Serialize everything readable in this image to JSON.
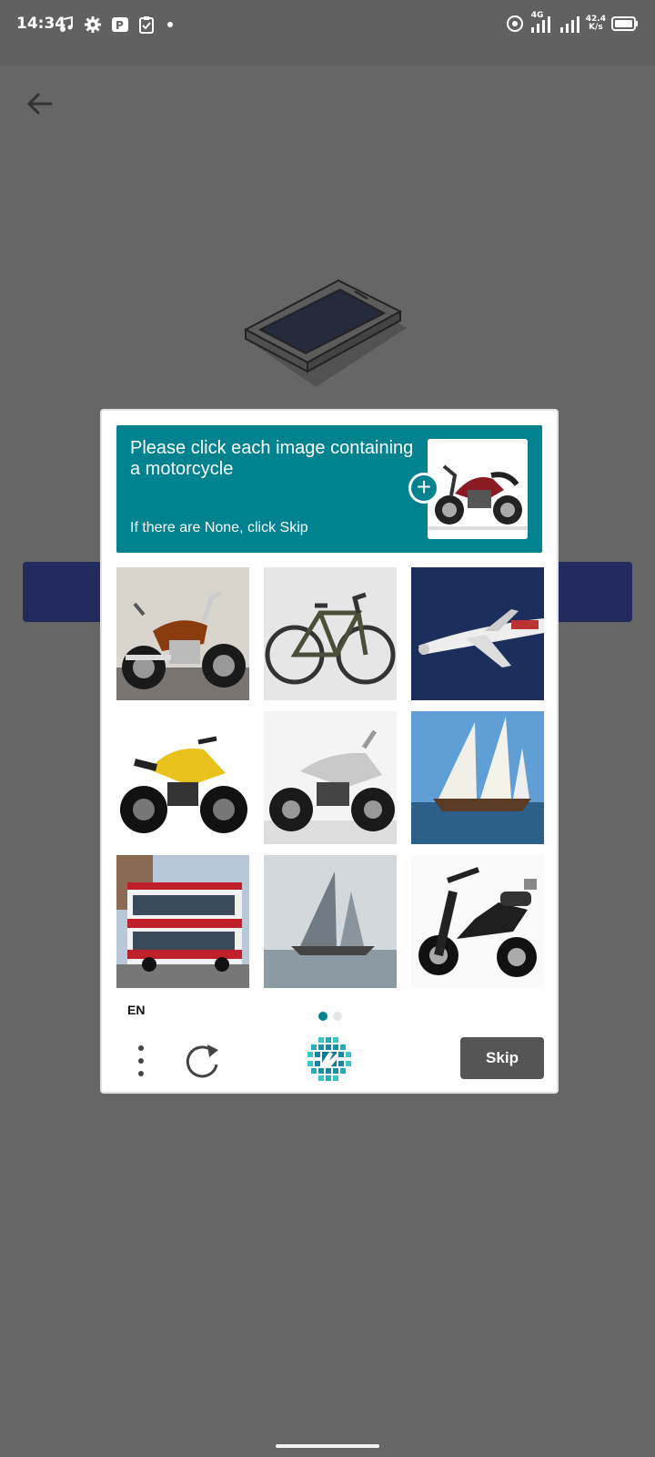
{
  "status_bar": {
    "time": "14:34",
    "network": "4G",
    "speed_value": "42.4",
    "speed_unit": "K/s",
    "icons": [
      "music-note-icon",
      "settings-gear-icon",
      "parking-app-icon",
      "clipboard-icon",
      "dot-icon",
      "hotspot-icon",
      "signal-icon",
      "signal-icon",
      "battery-icon"
    ]
  },
  "app": {
    "back_icon": "arrow-left-icon",
    "illustration": "phone-illustration",
    "primary_button_color": "#232a5e"
  },
  "captcha": {
    "prompt": "Please click each image containing a motorcycle",
    "sub_prompt": "If there are None, click Skip",
    "prompt_color": "#00838f",
    "example_image": "motorcycle",
    "tiles": [
      {
        "label": "motorcycle-cruiser"
      },
      {
        "label": "bicycle"
      },
      {
        "label": "airplane"
      },
      {
        "label": "motorcycle-yellow"
      },
      {
        "label": "motorcycle-silver"
      },
      {
        "label": "sailboat"
      },
      {
        "label": "double-decker-bus"
      },
      {
        "label": "sailboat-grey"
      },
      {
        "label": "scooter"
      }
    ],
    "language": "EN",
    "page_indicator": {
      "current": 1,
      "total": 2
    },
    "skip_label": "Skip",
    "menu_icon": "more-vertical-icon",
    "refresh_icon": "refresh-icon",
    "logo_icon": "hcaptcha-logo-icon"
  }
}
